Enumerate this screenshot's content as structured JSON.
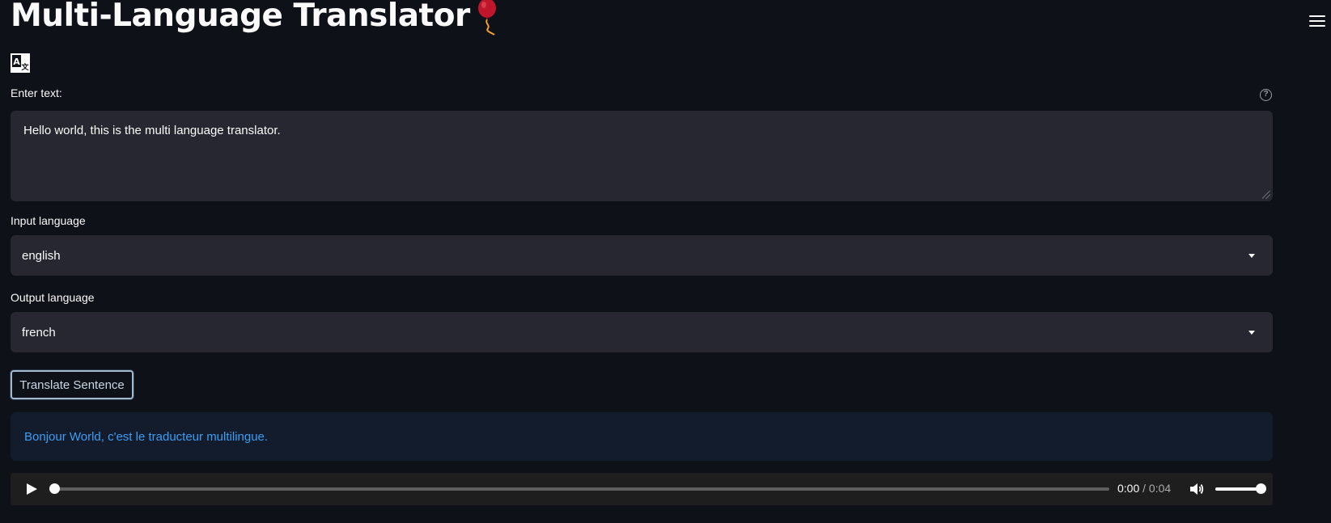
{
  "app": {
    "title": "Multi-Language Translator",
    "title_icon": "balloon-icon",
    "logo_icon": "translate-icon",
    "menu_icon": "hamburger-menu-icon"
  },
  "input": {
    "label": "Enter text:",
    "help_icon": "help-circle-icon",
    "value": "Hello world, this is the multi language translator."
  },
  "input_language": {
    "label": "Input language",
    "selected": "english"
  },
  "output_language": {
    "label": "Output language",
    "selected": "french"
  },
  "translate_button": {
    "label": "Translate Sentence"
  },
  "result": {
    "text": "Bonjour World, c'est le traducteur multilingue."
  },
  "audio": {
    "current_time": "0:00",
    "separator": "/",
    "duration": "0:04",
    "progress": 0,
    "volume": 1
  },
  "colors": {
    "background": "#0e1117",
    "field": "#262730",
    "result_bg": "#121c2c",
    "result_text": "#3d9df3",
    "balloon": "#c0162b"
  }
}
